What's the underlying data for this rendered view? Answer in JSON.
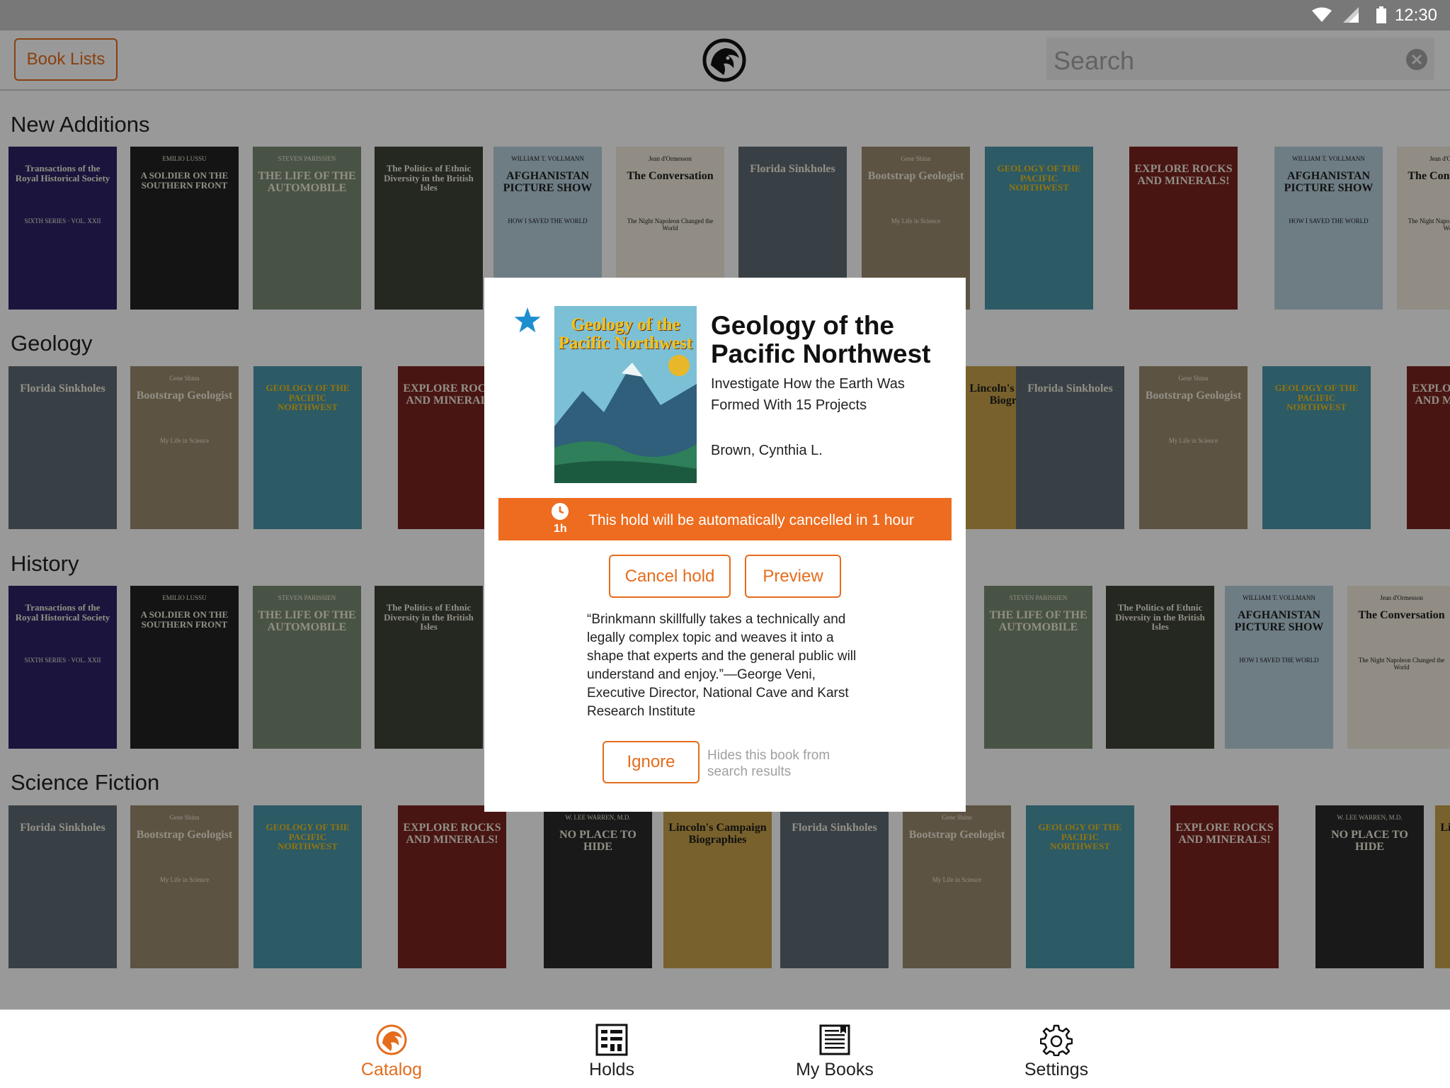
{
  "status_bar": {
    "time": "12:30"
  },
  "app_bar": {
    "book_lists_label": "Book Lists",
    "search_placeholder": "Search"
  },
  "sections": [
    {
      "title": "New Additions"
    },
    {
      "title": "Geology"
    },
    {
      "title": "History"
    },
    {
      "title": "Science Fiction"
    }
  ],
  "book_covers": {
    "transactions": {
      "title": "Transactions of the Royal Historical Society",
      "sub": "SIXTH SERIES · VOL. XXII",
      "color": "#2d2466"
    },
    "soldier": {
      "title": "A SOLDIER ON THE SOUTHERN FRONT",
      "author": "EMILIO LUSSU",
      "color": "#222222"
    },
    "automobile": {
      "title": "THE LIFE OF THE AUTOMOBILE",
      "author": "STEVEN PARISSIEN",
      "color": "#7b8a73"
    },
    "politics": {
      "title": "The Politics of Ethnic Diversity in the British Isles",
      "color": "#3c4336"
    },
    "afghanistan": {
      "title": "AFGHANISTAN PICTURE SHOW",
      "author": "WILLIAM T. VOLLMANN",
      "sub": "HOW I SAVED THE WORLD",
      "color": "#b7d1dc"
    },
    "conversation": {
      "title": "The Conversation",
      "author": "Jean d'Ormesson",
      "sub": "The Night Napoleon Changed the World",
      "color": "#f2ecdc"
    },
    "sinkholes": {
      "title": "Florida Sinkholes",
      "color": "#5f6b74"
    },
    "bootstrap": {
      "title": "Bootstrap Geologist",
      "author": "Gene Shinn",
      "sub": "My Life in Science",
      "color": "#9b8a6e"
    },
    "geology": {
      "title": "GEOLOGY OF THE PACIFIC NORTHWEST",
      "color": "#4a97a8"
    },
    "rocks": {
      "title": "EXPLORE ROCKS AND MINERALS!",
      "color": "#7a2320"
    },
    "hide": {
      "title": "NO PLACE TO HIDE",
      "author": "W. LEE WARREN, M.D.",
      "color": "#2a2a2a"
    },
    "lincoln": {
      "title": "Lincoln's Campaign Biographies",
      "color": "#c9a24a"
    }
  },
  "dialog": {
    "title": "Geology of the Pacific Northwest",
    "subtitle": "Investigate How the Earth Was Formed With 15 Projects",
    "author": "Brown, Cynthia L.",
    "hold_notice": "This hold will be automatically cancelled in 1 hour",
    "clock_label": "1h",
    "cancel_hold_label": "Cancel hold",
    "preview_label": "Preview",
    "quote": "“Brinkmann skillfully takes a technically and legally complex topic and weaves it into a shape that experts and the general public will understand and enjoy.”—George Veni, Executive Director, National Cave and Karst Research Institute",
    "ignore_label": "Ignore",
    "ignore_hint": "Hides this book from search results",
    "accent_color": "#ed6c1f",
    "star_color": "#1d8fcf"
  },
  "tabs": [
    {
      "label": "Catalog",
      "icon": "lion-logo-icon",
      "active": true
    },
    {
      "label": "Holds",
      "icon": "holds-list-icon",
      "active": false
    },
    {
      "label": "My Books",
      "icon": "my-books-icon",
      "active": false
    },
    {
      "label": "Settings",
      "icon": "gear-icon",
      "active": false
    }
  ]
}
